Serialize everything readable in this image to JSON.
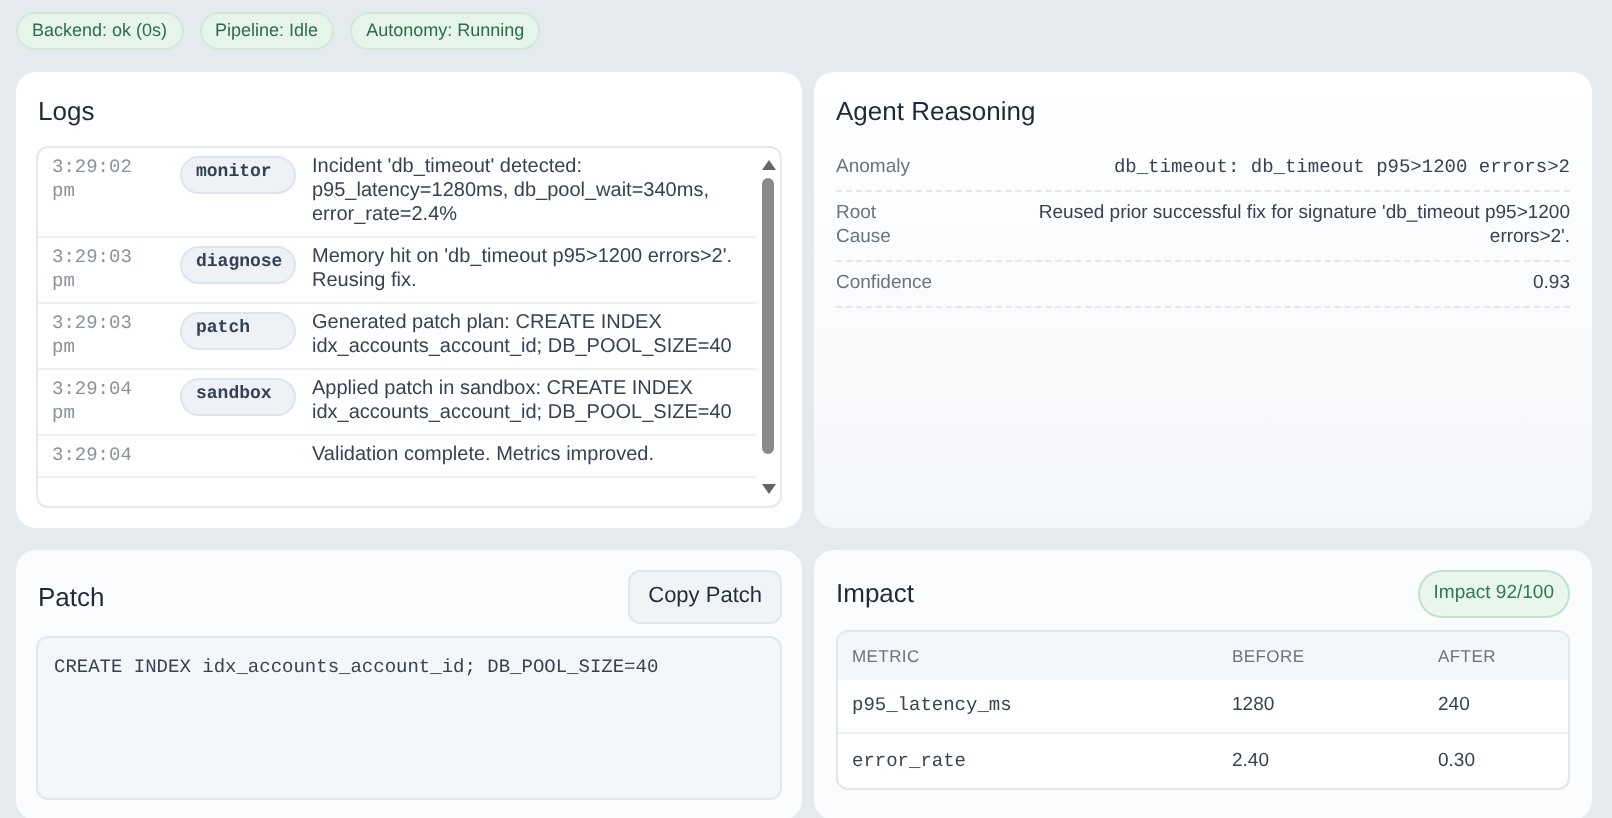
{
  "status_badges": [
    "Backend: ok (0s)",
    "Pipeline: Idle",
    "Autonomy: Running"
  ],
  "logs": {
    "title": "Logs",
    "entries": [
      {
        "time": "3:29:02 pm",
        "stage": "monitor",
        "message": "Incident 'db_timeout' detected: p95_latency=1280ms, db_pool_wait=340ms, error_rate=2.4%"
      },
      {
        "time": "3:29:03 pm",
        "stage": "diagnose",
        "message": "Memory hit on 'db_timeout p95>1200 errors>2'. Reusing fix."
      },
      {
        "time": "3:29:03 pm",
        "stage": "patch",
        "message": "Generated patch plan: CREATE INDEX idx_accounts_account_id; DB_POOL_SIZE=40"
      },
      {
        "time": "3:29:04 pm",
        "stage": "sandbox",
        "message": "Applied patch in sandbox: CREATE INDEX idx_accounts_account_id; DB_POOL_SIZE=40"
      },
      {
        "time": "3:29:04",
        "message": "Validation complete. Metrics improved."
      }
    ]
  },
  "reasoning": {
    "title": "Agent Reasoning",
    "rows": [
      {
        "label": "Anomaly",
        "value": "db_timeout: db_timeout p95>1200 errors>2",
        "kind": "code"
      },
      {
        "label": "Root Cause",
        "value": "Reused prior successful fix for signature 'db_timeout p95>1200 errors>2'.",
        "kind": "text"
      },
      {
        "label": "Confidence",
        "value": "0.93",
        "kind": "text"
      }
    ]
  },
  "patch": {
    "title": "Patch",
    "button": "Copy Patch",
    "code": "CREATE INDEX idx_accounts_account_id; DB_POOL_SIZE=40"
  },
  "impact": {
    "title": "Impact",
    "badge": "Impact 92/100",
    "columns": [
      "METRIC",
      "BEFORE",
      "AFTER"
    ],
    "rows": [
      [
        "p95_latency_ms",
        "1280",
        "240"
      ],
      [
        "error_rate",
        "2.40",
        "0.30"
      ]
    ]
  }
}
